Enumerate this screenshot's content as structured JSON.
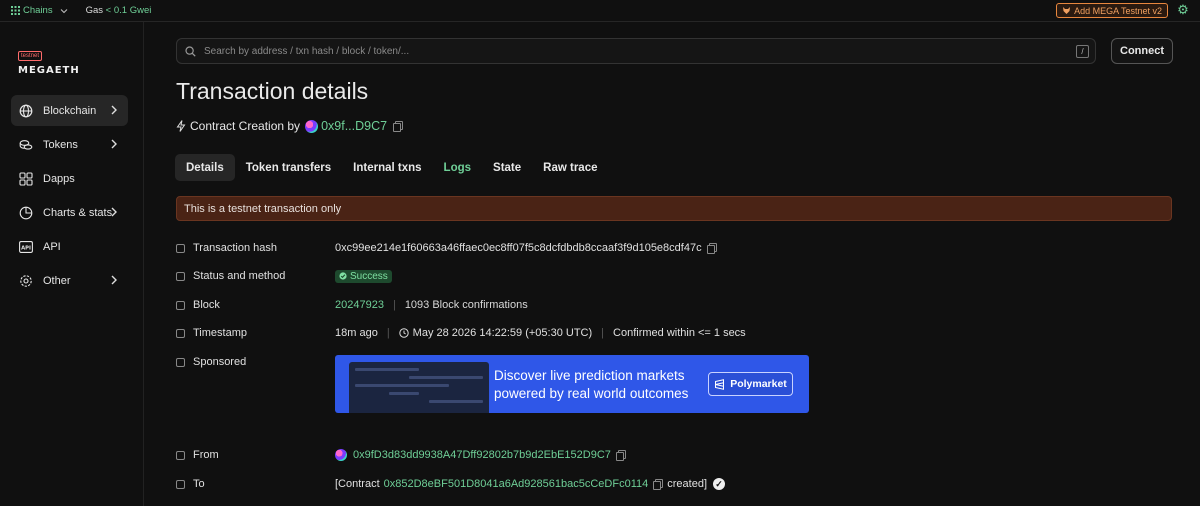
{
  "topbar": {
    "chains_label": "Chains",
    "gas_label": "Gas",
    "gas_value": "< 0.1 Gwei",
    "add_network_label": "Add MEGA Testnet v2"
  },
  "logo": {
    "badge": "testnet",
    "name": "MEGAETH"
  },
  "sidebar": {
    "items": [
      {
        "label": "Blockchain",
        "icon": "globe-icon",
        "chevron": true,
        "active": true
      },
      {
        "label": "Tokens",
        "icon": "coins-icon",
        "chevron": true
      },
      {
        "label": "Dapps",
        "icon": "grid-icon",
        "chevron": false
      },
      {
        "label": "Charts & stats",
        "icon": "chart-icon",
        "chevron": true
      },
      {
        "label": "API",
        "icon": "api-icon",
        "chevron": false
      },
      {
        "label": "Other",
        "icon": "gear-icon",
        "chevron": true
      }
    ]
  },
  "search": {
    "placeholder": "Search by address / txn hash / block / token/...",
    "shortcut": "/"
  },
  "connect_label": "Connect",
  "page": {
    "title": "Transaction details",
    "subtitle_prefix": "Contract Creation by",
    "creator_short": "0x9f...D9C7"
  },
  "tabs": [
    {
      "label": "Details",
      "active": true
    },
    {
      "label": "Token transfers"
    },
    {
      "label": "Internal txns"
    },
    {
      "label": "Logs",
      "highlight": true
    },
    {
      "label": "State"
    },
    {
      "label": "Raw trace"
    }
  ],
  "banner": "This is a testnet transaction only",
  "details": {
    "hash_label": "Transaction hash",
    "hash_value": "0xc99ee214e1f60663a46ffaec0ec8ff07f5c8dcfdbdb8ccaaf3f9d105e8cdf47c",
    "status_label": "Status and method",
    "status_value": "Success",
    "block_label": "Block",
    "block_value": "20247923",
    "block_confirmations": "1093 Block confirmations",
    "timestamp_label": "Timestamp",
    "timestamp_ago": "18m ago",
    "timestamp_value": "May 28 2026 14:22:59 (+05:30 UTC)",
    "timestamp_confirmed": "Confirmed within <= 1 secs",
    "sponsored_label": "Sponsored",
    "from_label": "From",
    "from_value": "0x9fD3d83dd9938A47Dff92802b7b9d2EbE152D9C7",
    "to_label": "To",
    "to_prefix": "[Contract",
    "to_value": "0x852D8eBF501D8041a6Ad928561bac5cCeDFc0114",
    "to_suffix": "created]"
  },
  "ad": {
    "line1": "Discover live prediction markets",
    "line2": "powered by real world outcomes",
    "brand": "Polymarket",
    "background": "#2f57e8"
  },
  "colors": {
    "accent": "#6fcf97",
    "banner_bg": "#4a2315",
    "success_bg": "#1e4a2e"
  }
}
